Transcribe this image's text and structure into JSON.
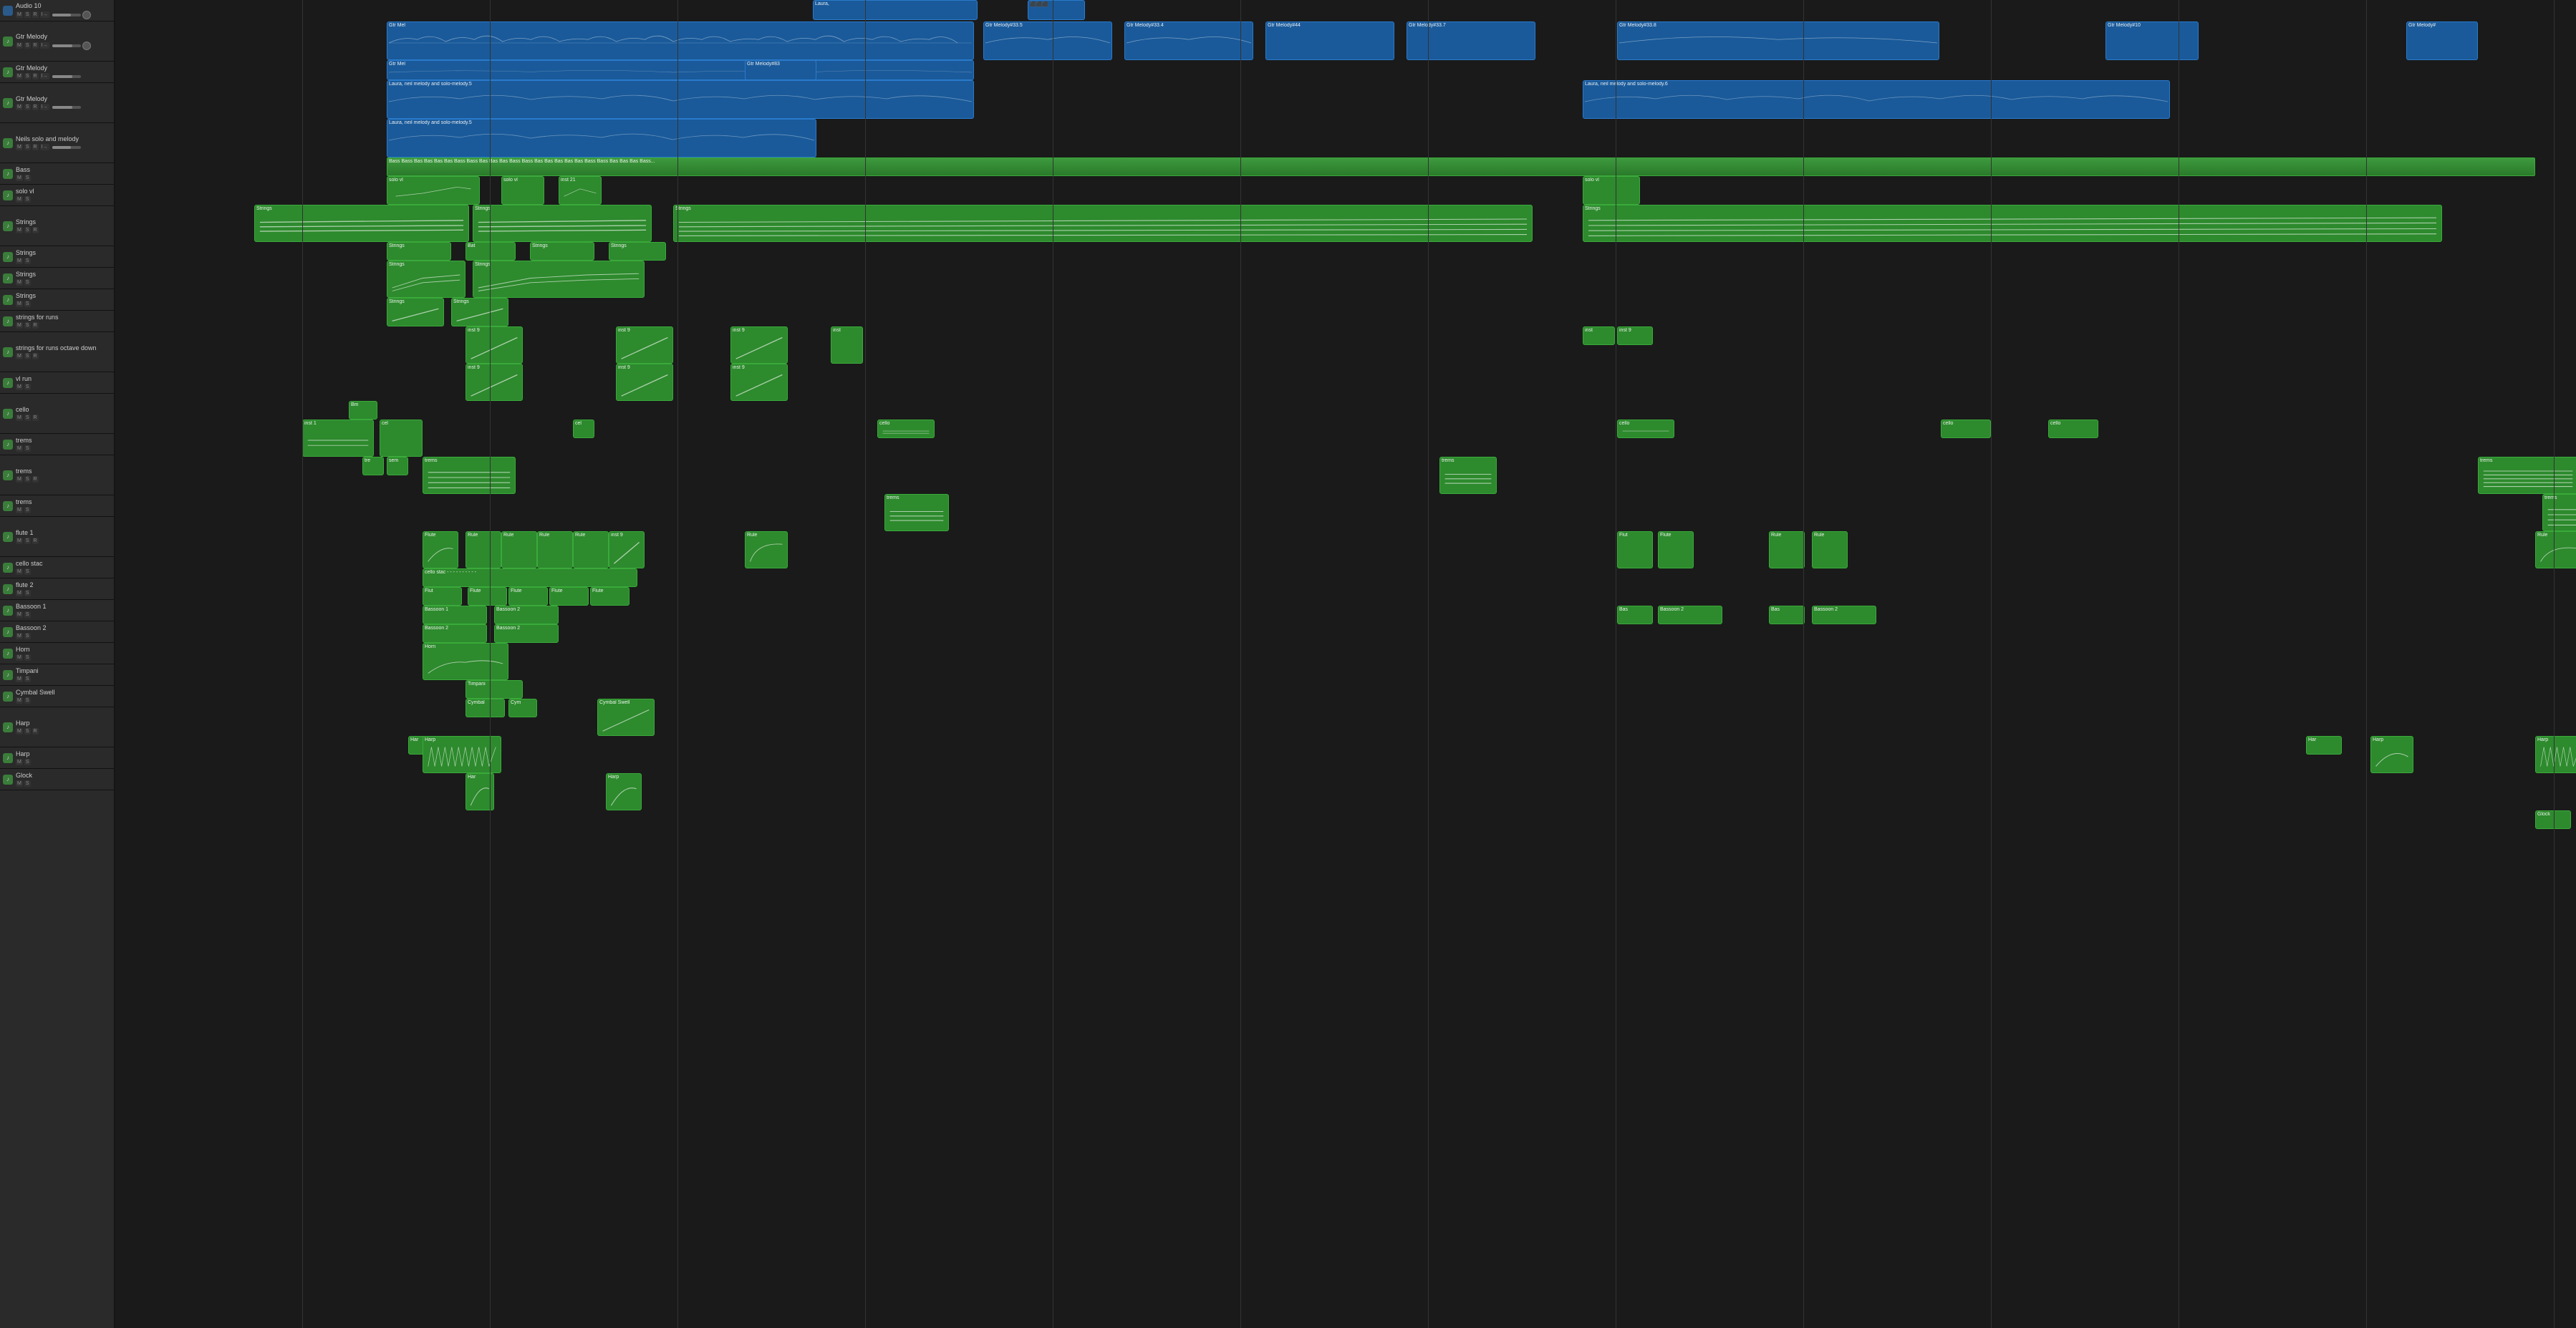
{
  "tracks": [
    {
      "id": 1,
      "name": "Audio 10",
      "type": "audio",
      "icon": "blue",
      "height": 56
    },
    {
      "id": 2,
      "name": "Gtr Melody",
      "type": "midi",
      "icon": "green",
      "height": 56
    },
    {
      "id": 3,
      "name": "Gtr Melody",
      "type": "midi",
      "icon": "green",
      "height": 56
    },
    {
      "id": 4,
      "name": "Gtr Melody",
      "type": "midi",
      "icon": "green",
      "height": 56
    },
    {
      "id": 5,
      "name": "Neils solo and melody",
      "type": "midi",
      "icon": "green",
      "height": 56
    },
    {
      "id": 6,
      "name": "Bass",
      "type": "midi",
      "icon": "green",
      "height": 56
    },
    {
      "id": 7,
      "name": "solo vl",
      "type": "midi",
      "icon": "green",
      "height": 56
    },
    {
      "id": 8,
      "name": "Strings",
      "type": "midi",
      "icon": "green",
      "height": 56
    },
    {
      "id": 9,
      "name": "Strings",
      "type": "midi",
      "icon": "green",
      "height": 56
    },
    {
      "id": 10,
      "name": "Strings",
      "type": "midi",
      "icon": "green",
      "height": 56
    },
    {
      "id": 11,
      "name": "Strings",
      "type": "midi",
      "icon": "green",
      "height": 56
    },
    {
      "id": 12,
      "name": "strings for runs",
      "type": "midi",
      "icon": "green",
      "height": 56
    },
    {
      "id": 13,
      "name": "strings for runs octave down",
      "type": "midi",
      "icon": "green",
      "height": 56
    },
    {
      "id": 14,
      "name": "vl run",
      "type": "midi",
      "icon": "green",
      "height": 56
    },
    {
      "id": 15,
      "name": "cello",
      "type": "midi",
      "icon": "green",
      "height": 56
    },
    {
      "id": 16,
      "name": "trems",
      "type": "midi",
      "icon": "green",
      "height": 56
    },
    {
      "id": 17,
      "name": "trems",
      "type": "midi",
      "icon": "green",
      "height": 56
    },
    {
      "id": 18,
      "name": "trems",
      "type": "midi",
      "icon": "green",
      "height": 56
    },
    {
      "id": 19,
      "name": "flute 1",
      "type": "midi",
      "icon": "green",
      "height": 56
    },
    {
      "id": 20,
      "name": "cello stac",
      "type": "midi",
      "icon": "green",
      "height": 56
    },
    {
      "id": 21,
      "name": "flute 2",
      "type": "midi",
      "icon": "green",
      "height": 56
    },
    {
      "id": 22,
      "name": "Bassoon 1",
      "type": "midi",
      "icon": "green",
      "height": 56
    },
    {
      "id": 23,
      "name": "Bassoon 2",
      "type": "midi",
      "icon": "green",
      "height": 56
    },
    {
      "id": 24,
      "name": "Horn",
      "type": "midi",
      "icon": "green",
      "height": 56
    },
    {
      "id": 25,
      "name": "Timpani",
      "type": "midi",
      "icon": "green",
      "height": 56
    },
    {
      "id": 26,
      "name": "Cymbal Swell",
      "type": "midi",
      "icon": "green",
      "height": 56
    },
    {
      "id": 27,
      "name": "Harp",
      "type": "midi",
      "icon": "green",
      "height": 56
    },
    {
      "id": 28,
      "name": "Harp",
      "type": "midi",
      "icon": "green",
      "height": 56
    },
    {
      "id": 29,
      "name": "Glock",
      "type": "midi",
      "icon": "green",
      "height": 56
    }
  ],
  "colors": {
    "bg": "#1a1a1a",
    "sidebar": "#2a2a2a",
    "green_region": "#2d8a2d",
    "blue_region": "#1a5a9a",
    "track_border": "#111"
  }
}
